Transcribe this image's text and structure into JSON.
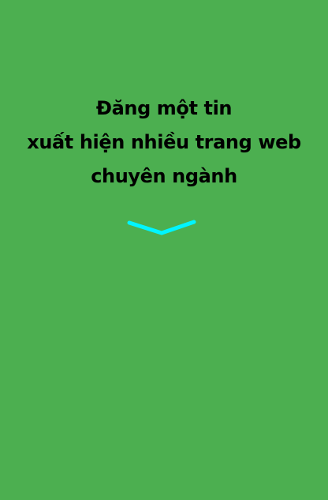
{
  "promo": {
    "headline": {
      "line1": "Đăng một tin",
      "line2": "xuất hiện nhiều trang web",
      "line3": "chuyên ngành"
    },
    "expand_icon": "chevron-down-icon",
    "background_color": "#4caf50",
    "text_color": "#000000",
    "chevron_color": "#00f5ff"
  }
}
